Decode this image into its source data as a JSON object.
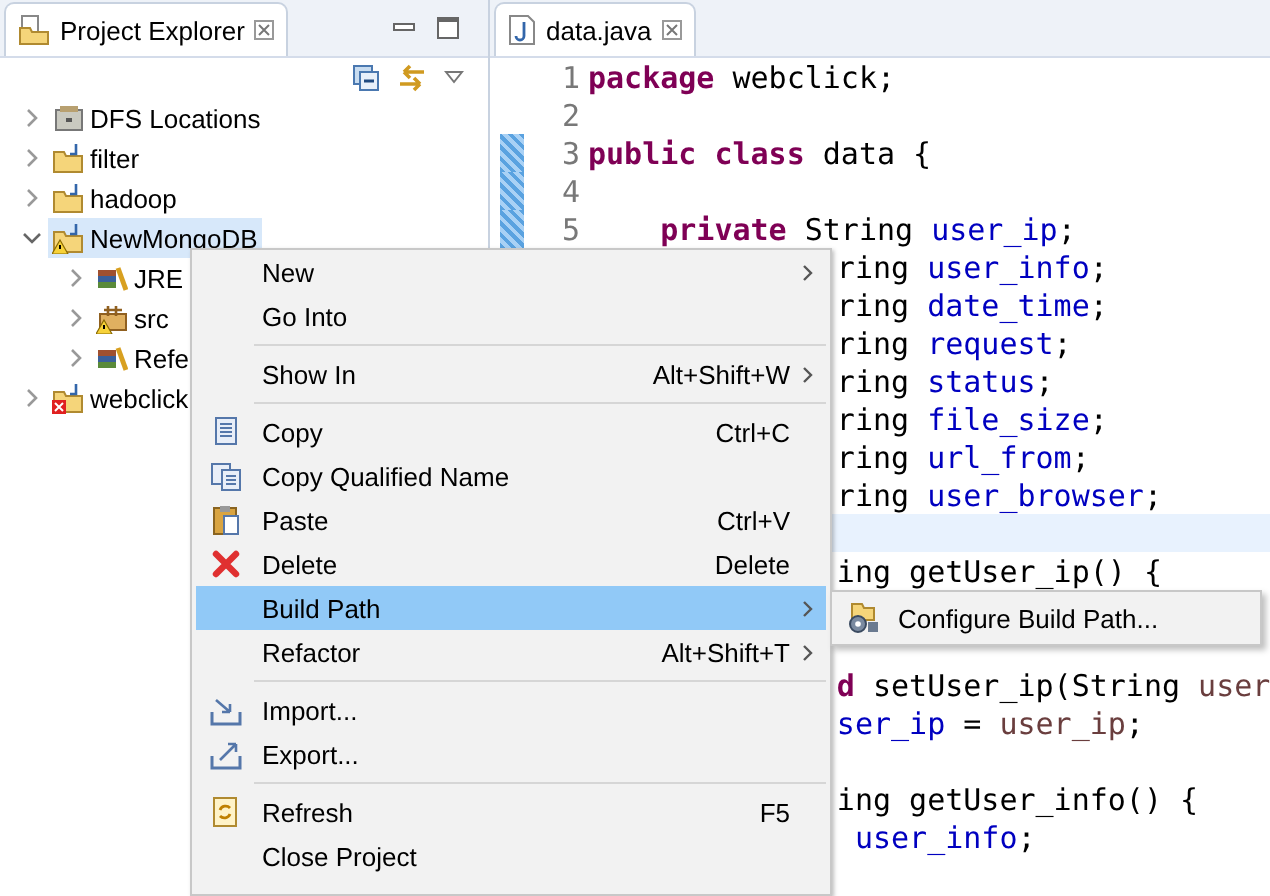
{
  "explorer": {
    "title": "Project Explorer",
    "tree": [
      {
        "label": "DFS Locations",
        "kind": "locations",
        "warning": false,
        "error": false,
        "expanded": false,
        "selected": false
      },
      {
        "label": "filter",
        "kind": "project",
        "warning": false,
        "error": false,
        "expanded": false,
        "selected": false
      },
      {
        "label": "hadoop",
        "kind": "project",
        "warning": false,
        "error": false,
        "expanded": false,
        "selected": false
      },
      {
        "label": "NewMongoDB",
        "kind": "project",
        "warning": true,
        "error": false,
        "expanded": true,
        "selected": true,
        "children": [
          {
            "label": "JRE",
            "kind": "library",
            "warning": false,
            "error": false,
            "expanded": false,
            "selected": false
          },
          {
            "label": "src",
            "kind": "source",
            "warning": true,
            "error": false,
            "expanded": false,
            "selected": false
          },
          {
            "label": "Refe",
            "kind": "library",
            "warning": false,
            "error": false,
            "expanded": false,
            "selected": false
          }
        ]
      },
      {
        "label": "webclick",
        "kind": "project",
        "warning": false,
        "error": true,
        "expanded": false,
        "selected": false
      }
    ]
  },
  "editor": {
    "tab": "data.java",
    "lines": [
      {
        "number": "1",
        "changed": false,
        "current": false,
        "tokens": [
          {
            "kind": "keyword",
            "text": "package"
          },
          {
            "kind": "plain",
            "text": " webclick;"
          }
        ]
      },
      {
        "number": "2",
        "changed": false,
        "current": false
      },
      {
        "number": "3",
        "changed": true,
        "current": false,
        "tokens": [
          {
            "kind": "keyword",
            "text": "public"
          },
          {
            "kind": "keyword",
            "text": " class"
          },
          {
            "kind": "plain",
            "text": " data {"
          }
        ]
      },
      {
        "number": "4",
        "changed": true,
        "current": false
      },
      {
        "number": "5",
        "changed": true,
        "current": false,
        "tokens": [
          {
            "kind": "keyword",
            "text": "    private"
          },
          {
            "kind": "plain",
            "text": " String "
          },
          {
            "kind": "field",
            "text": "user_ip"
          },
          {
            "kind": "plain",
            "text": ";"
          }
        ]
      },
      {
        "current": false,
        "tokens": [
          {
            "kind": "plain",
            "text": "ring "
          },
          {
            "kind": "field",
            "text": "user_info"
          },
          {
            "kind": "plain",
            "text": ";"
          }
        ]
      },
      {
        "current": false,
        "tokens": [
          {
            "kind": "plain",
            "text": "ring "
          },
          {
            "kind": "field",
            "text": "date_time"
          },
          {
            "kind": "plain",
            "text": ";"
          }
        ]
      },
      {
        "current": false,
        "tokens": [
          {
            "kind": "plain",
            "text": "ring "
          },
          {
            "kind": "field",
            "text": "request"
          },
          {
            "kind": "plain",
            "text": ";"
          }
        ]
      },
      {
        "current": false,
        "tokens": [
          {
            "kind": "plain",
            "text": "ring "
          },
          {
            "kind": "field",
            "text": "status"
          },
          {
            "kind": "plain",
            "text": ";"
          }
        ]
      },
      {
        "current": false,
        "tokens": [
          {
            "kind": "plain",
            "text": "ring "
          },
          {
            "kind": "field",
            "text": "file_size"
          },
          {
            "kind": "plain",
            "text": ";"
          }
        ]
      },
      {
        "current": false,
        "tokens": [
          {
            "kind": "plain",
            "text": "ring "
          },
          {
            "kind": "field",
            "text": "url_from"
          },
          {
            "kind": "plain",
            "text": ";"
          }
        ]
      },
      {
        "current": false,
        "tokens": [
          {
            "kind": "plain",
            "text": "ring "
          },
          {
            "kind": "field",
            "text": "user_browser"
          },
          {
            "kind": "plain",
            "text": ";"
          }
        ]
      },
      {
        "current": true
      },
      {
        "current": false,
        "tokens": [
          {
            "kind": "plain",
            "text": "ing getUser_ip() {"
          }
        ]
      },
      {
        "current": false
      },
      {
        "current": false
      },
      {
        "current": false,
        "tokens": [
          {
            "kind": "keyword",
            "text": "d"
          },
          {
            "kind": "plain",
            "text": " setUser_ip(String "
          },
          {
            "kind": "param",
            "text": "user"
          }
        ]
      },
      {
        "current": false,
        "tokens": [
          {
            "kind": "field",
            "text": "ser_ip"
          },
          {
            "kind": "plain",
            "text": " = "
          },
          {
            "kind": "param",
            "text": "user_ip"
          },
          {
            "kind": "plain",
            "text": ";"
          }
        ]
      },
      {
        "current": false
      },
      {
        "current": false,
        "tokens": [
          {
            "kind": "plain",
            "text": "ing getUser_info() {"
          }
        ]
      },
      {
        "current": false,
        "tokens": [
          {
            "kind": "field",
            "text": " user_info"
          },
          {
            "kind": "plain",
            "text": ";"
          }
        ]
      },
      {
        "current": false
      }
    ]
  },
  "context_menu": {
    "items": [
      {
        "kind": "item",
        "label": "New",
        "submenu": true,
        "selected": false
      },
      {
        "kind": "item",
        "label": "Go Into",
        "submenu": false,
        "selected": false
      },
      {
        "kind": "separator"
      },
      {
        "kind": "item",
        "label": "Show In",
        "shortcut": "Alt+Shift+W",
        "submenu": true,
        "selected": false
      },
      {
        "kind": "separator"
      },
      {
        "kind": "item",
        "label": "Copy",
        "shortcut": "Ctrl+C",
        "submenu": false,
        "selected": false
      },
      {
        "kind": "item",
        "label": "Copy Qualified Name",
        "submenu": false,
        "selected": false
      },
      {
        "kind": "item",
        "label": "Paste",
        "shortcut": "Ctrl+V",
        "submenu": false,
        "selected": false
      },
      {
        "kind": "item",
        "label": "Delete",
        "shortcut": "Delete",
        "submenu": false,
        "selected": false
      },
      {
        "kind": "item",
        "label": "Build Path",
        "submenu": true,
        "selected": true
      },
      {
        "kind": "item",
        "label": "Refactor",
        "shortcut": "Alt+Shift+T",
        "submenu": true,
        "selected": false
      },
      {
        "kind": "separator"
      },
      {
        "kind": "item",
        "label": "Import...",
        "submenu": false,
        "selected": false
      },
      {
        "kind": "item",
        "label": "Export...",
        "submenu": false,
        "selected": false
      },
      {
        "kind": "separator"
      },
      {
        "kind": "item",
        "label": "Refresh",
        "shortcut": "F5",
        "submenu": false,
        "selected": false
      },
      {
        "kind": "item",
        "label": "Close Project",
        "submenu": false,
        "selected": false
      }
    ]
  },
  "submenu": {
    "items": [
      {
        "label": "Configure Build Path..."
      }
    ]
  }
}
